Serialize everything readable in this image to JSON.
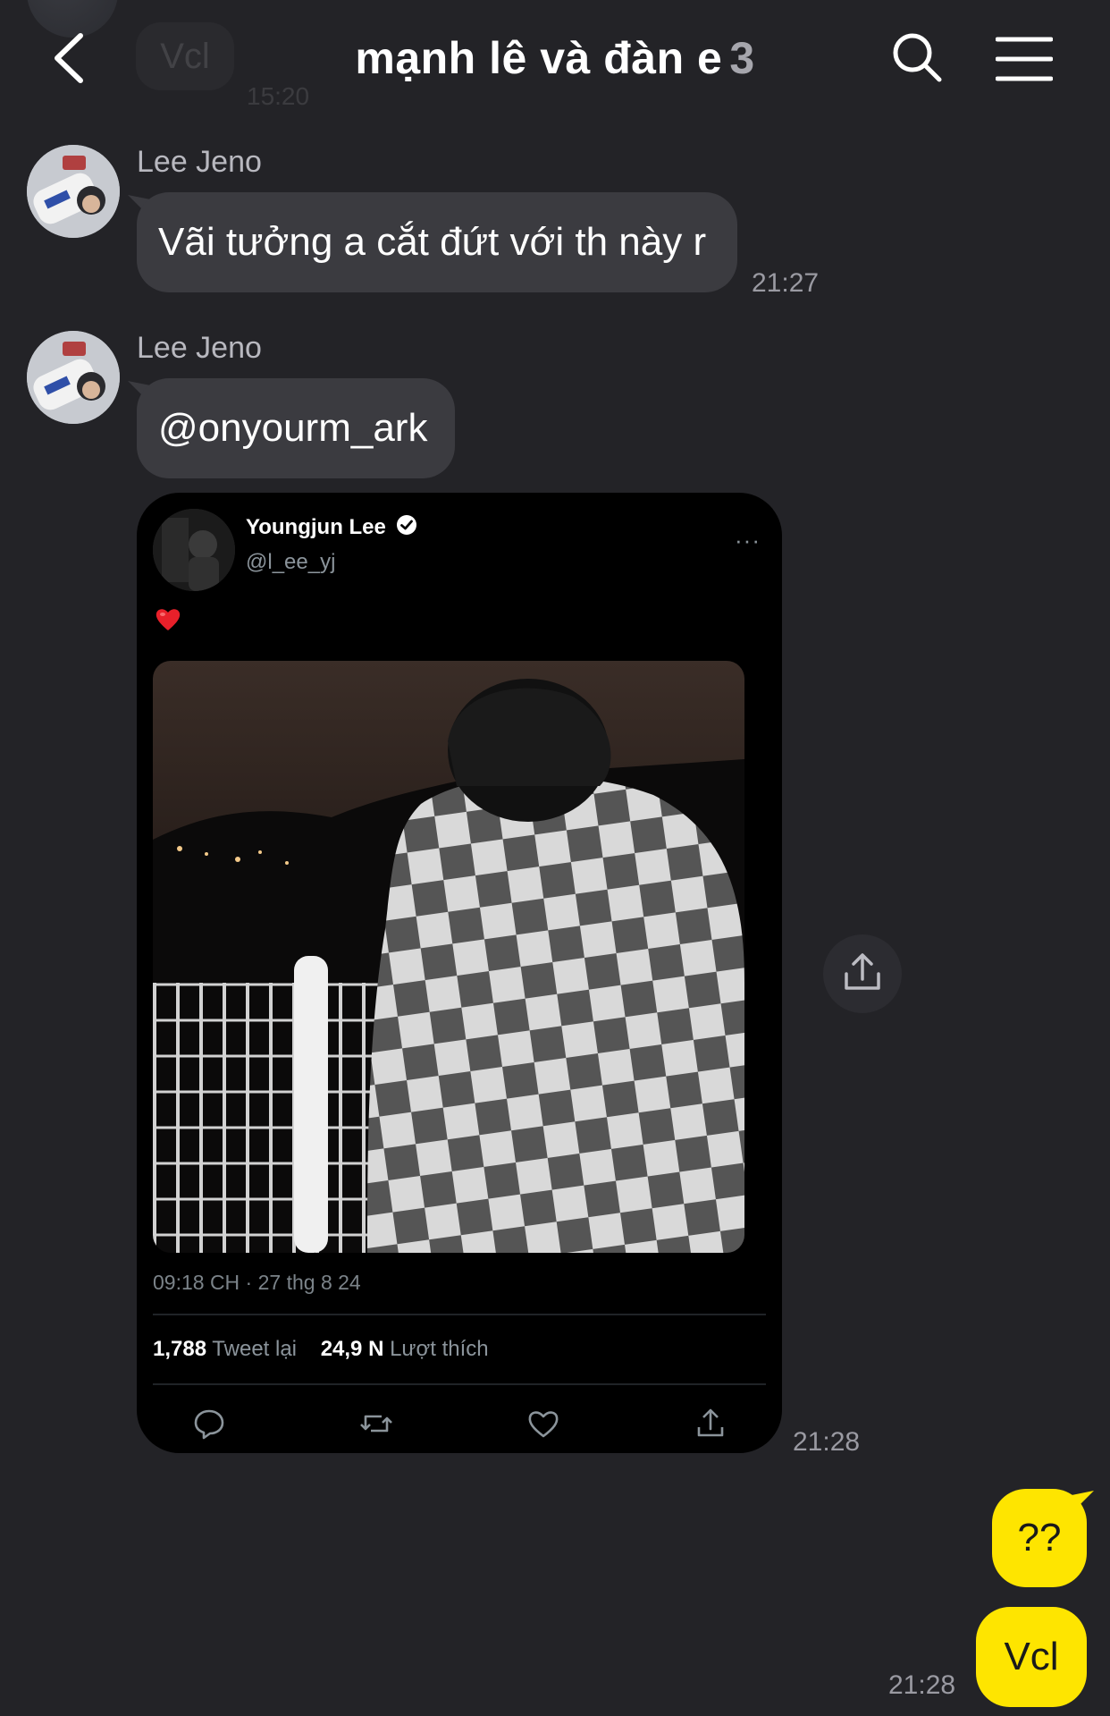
{
  "header": {
    "title": "mạnh lê và đàn e",
    "member_count": "3"
  },
  "previous": {
    "text": "Vcl",
    "time": "15:20"
  },
  "messages": [
    {
      "sender": "Lee Jeno",
      "text": "Vãi tưởng a cắt đứt với th này r",
      "time": "21:27"
    },
    {
      "sender": "Lee Jeno",
      "text": "@onyourm_ark",
      "time": "21:28"
    }
  ],
  "tweet": {
    "name": "Youngjun Lee",
    "handle": "@l_ee_yj",
    "more": "···",
    "date": "09:18 CH · 27 thg 8 24",
    "retweets": "1,788",
    "retweets_label": "Tweet lại",
    "likes": "24,9 N",
    "likes_label": "Lượt thích"
  },
  "outgoing": [
    {
      "text": "??"
    },
    {
      "text": "Vcl"
    }
  ],
  "outgoing_time": "21:28",
  "icons": {
    "back": "chevron-left-icon",
    "search": "search-icon",
    "menu": "hamburger-menu-icon",
    "share": "share-upload-icon",
    "verified": "verified-badge-icon",
    "heart_emoji": "red-heart-icon"
  },
  "colors": {
    "background": "#232327",
    "incoming_bubble": "#3b3b40",
    "outgoing_bubble": "#fee500",
    "tweet_background": "#000000"
  }
}
